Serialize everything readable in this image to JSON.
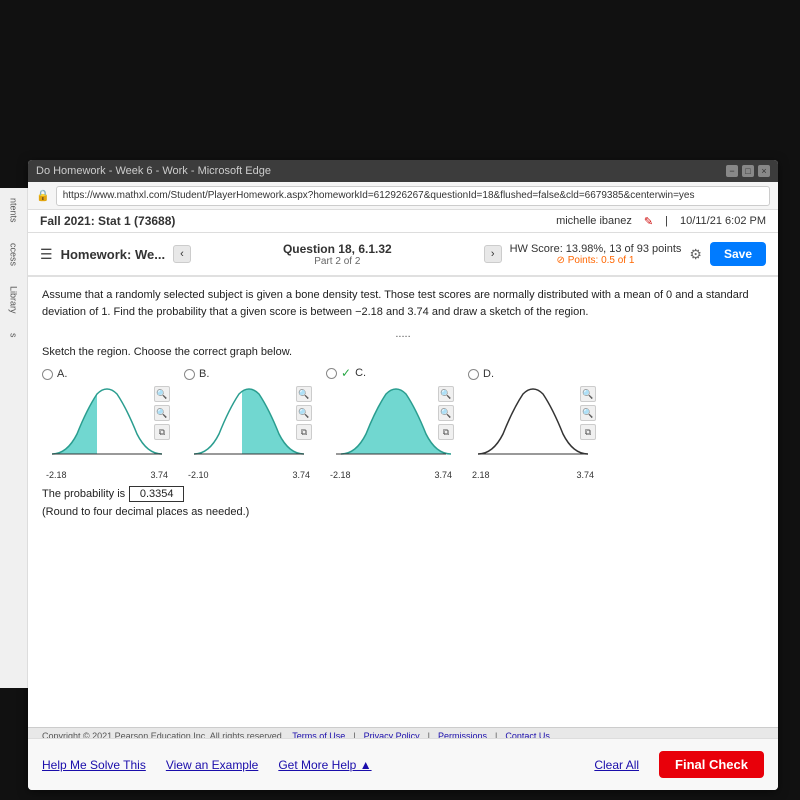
{
  "browser": {
    "title": "Do Homework - Week 6 - Work - Microsoft Edge",
    "url": "https://www.mathxl.com/Student/PlayerHomework.aspx?homeworkId=612926267&questionId=18&flushed=false&cld=6679385&centerwin=yes"
  },
  "app_header": {
    "course": "Fall 2021: Stat 1 (73688)",
    "user": "michelle ibanez",
    "datetime": "10/11/21 6:02 PM"
  },
  "nav": {
    "homework_label": "Homework: We...",
    "question_label": "Question 18, 6.1.32",
    "part_label": "Part 2 of 2",
    "hw_score_label": "HW Score: 13.98%, 13 of 93 points",
    "points_label": "Points: 0.5 of 1",
    "save_label": "Save"
  },
  "question": {
    "text": "Assume that a randomly selected subject is given a bone density test. Those test scores are normally distributed with a mean of 0 and a standard deviation of 1. Find the probability that a given score is between −2.18 and 3.74 and draw a sketch of the region.",
    "sketch_label": "Sketch the region. Choose the correct graph below.",
    "more_dots": ".....",
    "options": [
      {
        "id": "A",
        "selected": false,
        "correct": false,
        "left_label": "-2.18",
        "right_label": "3.74",
        "shade": "left"
      },
      {
        "id": "B",
        "selected": false,
        "correct": false,
        "left_label": "-2.10",
        "right_label": "3.74",
        "shade": "right"
      },
      {
        "id": "C",
        "selected": true,
        "correct": true,
        "left_label": "-2.18",
        "right_label": "3.74",
        "shade": "middle"
      },
      {
        "id": "D",
        "selected": false,
        "correct": false,
        "left_label": "2.18",
        "right_label": "3.74",
        "shade": "narrow"
      }
    ]
  },
  "probability": {
    "label": "The probability is",
    "value": "0.3354",
    "note": "(Round to four decimal places as needed.)"
  },
  "bottom_bar": {
    "help_me_solve": "Help Me Solve This",
    "view_example": "View an Example",
    "get_more_help": "Get More Help ▲",
    "clear_all": "Clear All",
    "final_check": "Final Check"
  },
  "footer": {
    "copyright": "Copyright © 2021 Pearson Education Inc. All rights reserved.",
    "links": [
      "Terms of Use",
      "Privacy Policy",
      "Permissions",
      "Contact Us"
    ]
  },
  "sidebar": {
    "items": [
      "ntents",
      "ccess",
      "Library",
      "s"
    ]
  }
}
